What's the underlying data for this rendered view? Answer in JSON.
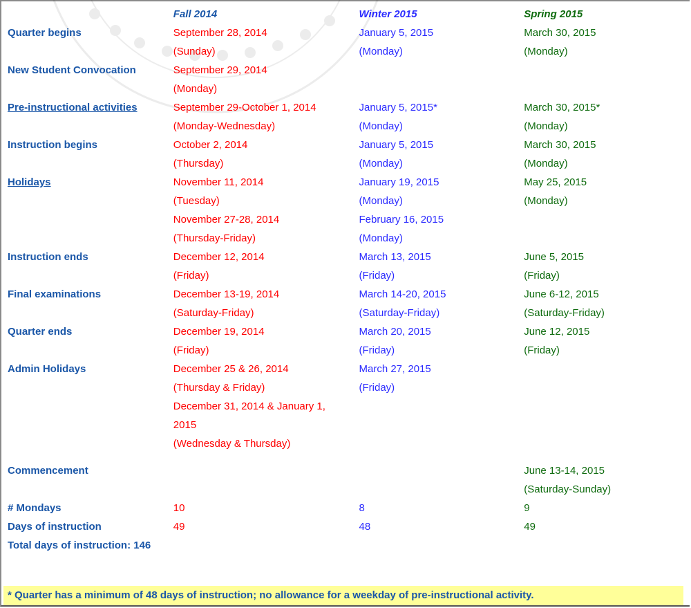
{
  "header": {
    "columns": [
      {
        "label": "Fall 2014",
        "color": "#1b57a8"
      },
      {
        "label": "Winter 2015",
        "color": "#2b2bff"
      },
      {
        "label": "Spring 2015",
        "color": "#0e6b0e"
      }
    ]
  },
  "colors": {
    "label": "#1b57a8",
    "fall": "#ff0000",
    "winter": "#2b2bff",
    "spring": "#0e6b0e",
    "footnote_bg": "#ffff99"
  },
  "rows": [
    {
      "label": "Quarter begins",
      "link": false,
      "fall": [
        "September 28, 2014",
        "(Sunday)"
      ],
      "winter": [
        "January 5, 2015",
        "(Monday)"
      ],
      "spring": [
        "March 30, 2015",
        "(Monday)"
      ]
    },
    {
      "label": "New Student Convocation",
      "link": false,
      "fall": [
        "September 29, 2014",
        "(Monday)"
      ],
      "winter": [],
      "spring": []
    },
    {
      "label": "Pre-instructional activities",
      "link": true,
      "fall": [
        "September 29-October 1, 2014",
        "(Monday-Wednesday)"
      ],
      "winter": [
        "January 5, 2015*",
        "(Monday)"
      ],
      "spring": [
        "March 30, 2015*",
        "(Monday)"
      ]
    },
    {
      "label": "Instruction begins",
      "link": false,
      "fall": [
        "October 2, 2014",
        "(Thursday)"
      ],
      "winter": [
        "January 5, 2015",
        "(Monday)"
      ],
      "spring": [
        "March 30, 2015",
        "(Monday)"
      ]
    },
    {
      "label": "Holidays",
      "link": true,
      "fall": [
        "November 11, 2014",
        "(Tuesday)",
        "November 27-28, 2014",
        "(Thursday-Friday)"
      ],
      "winter": [
        "January 19, 2015",
        "(Monday)",
        "February 16, 2015",
        "(Monday)"
      ],
      "spring": [
        "May 25, 2015",
        "(Monday)"
      ]
    },
    {
      "label": "Instruction ends",
      "link": false,
      "fall": [
        "December 12, 2014",
        "(Friday)"
      ],
      "winter": [
        "March 13, 2015",
        "(Friday)"
      ],
      "spring": [
        "June 5, 2015",
        "(Friday)"
      ]
    },
    {
      "label": "Final examinations",
      "link": false,
      "fall": [
        "December 13-19, 2014",
        "(Saturday-Friday)"
      ],
      "winter": [
        "March 14-20, 2015",
        "(Saturday-Friday)"
      ],
      "spring": [
        "June 6-12, 2015",
        "(Saturday-Friday)"
      ]
    },
    {
      "label": "Quarter ends",
      "link": false,
      "fall": [
        "December 19, 2014",
        "(Friday)"
      ],
      "winter": [
        "March 20, 2015",
        "(Friday)"
      ],
      "spring": [
        "June 12, 2015",
        "(Friday)"
      ]
    },
    {
      "label": "Admin Holidays",
      "link": false,
      "fall": [
        "December 25 & 26, 2014",
        "(Thursday & Friday)",
        "December 31, 2014 & January 1,",
        "2015",
        "(Wednesday & Thursday)"
      ],
      "winter": [
        "March 27, 2015",
        "(Friday)"
      ],
      "spring": []
    },
    {
      "label": "Commencement",
      "link": false,
      "fall": [],
      "winter": [],
      "spring": [
        "June 13-14, 2015",
        "(Saturday-Sunday)"
      ]
    },
    {
      "label": "# Mondays",
      "link": false,
      "fall": [
        "10"
      ],
      "winter": [
        "8"
      ],
      "spring": [
        "9"
      ]
    },
    {
      "label": "Days of instruction",
      "link": false,
      "fall": [
        "49"
      ],
      "winter": [
        "48"
      ],
      "spring": [
        "49"
      ]
    }
  ],
  "total": "Total days of instruction: 146",
  "footnote": "* Quarter has a minimum of 48 days of instruction; no allowance for a weekday of pre-instructional activity."
}
